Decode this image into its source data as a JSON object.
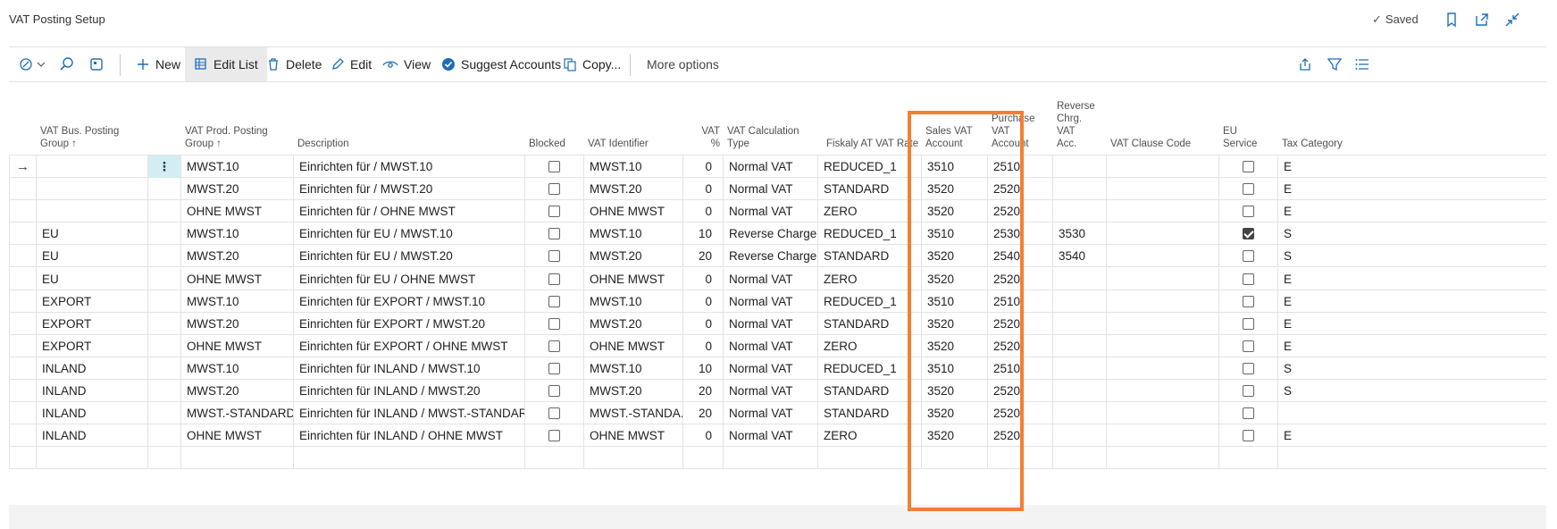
{
  "page": {
    "title": "VAT Posting Setup",
    "saved_label": "Saved"
  },
  "actions": {
    "new": "New",
    "edit_list": "Edit List",
    "delete": "Delete",
    "edit": "Edit",
    "view": "View",
    "suggest_accounts": "Suggest Accounts",
    "copy": "Copy...",
    "more_options": "More options"
  },
  "columns": {
    "bus_group_1": "VAT Bus. Posting",
    "bus_group_2": "Group ↑",
    "prod_group_1": "VAT Prod. Posting",
    "prod_group_2": "Group ↑",
    "description": "Description",
    "blocked": "Blocked",
    "vat_identifier": "VAT Identifier",
    "vat_pct_1": "VAT",
    "vat_pct_2": "%",
    "calc_type_1": "VAT Calculation",
    "calc_type_2": "Type",
    "fiskaly": "Fiskaly AT VAT Rate",
    "sales_acc_1": "Sales VAT",
    "sales_acc_2": "Account",
    "purch_acc_1": "Purchase",
    "purch_acc_2": "VAT",
    "purch_acc_3": "Account",
    "rev_1": "Reverse",
    "rev_2": "Chrg.",
    "rev_3": "VAT",
    "rev_4": "Acc.",
    "clause": "VAT Clause Code",
    "eu_1": "EU",
    "eu_2": "Service",
    "tax_cat": "Tax Category"
  },
  "rows": [
    {
      "bus": "",
      "prod": "MWST.10",
      "desc": "Einrichten für  / MWST.10",
      "blocked": false,
      "ident": "MWST.10",
      "pct": "0",
      "calc": "Normal VAT",
      "fisk": "REDUCED_1",
      "sales": "3510",
      "purch": "2510",
      "rev": "",
      "eu": false,
      "tax": "E"
    },
    {
      "bus": "",
      "prod": "MWST.20",
      "desc": "Einrichten für  / MWST.20",
      "blocked": false,
      "ident": "MWST.20",
      "pct": "0",
      "calc": "Normal VAT",
      "fisk": "STANDARD",
      "sales": "3520",
      "purch": "2520",
      "rev": "",
      "eu": false,
      "tax": "E"
    },
    {
      "bus": "",
      "prod": "OHNE MWST",
      "desc": "Einrichten für  / OHNE MWST",
      "blocked": false,
      "ident": "OHNE MWST",
      "pct": "0",
      "calc": "Normal VAT",
      "fisk": "ZERO",
      "sales": "3520",
      "purch": "2520",
      "rev": "",
      "eu": false,
      "tax": "E"
    },
    {
      "bus": "EU",
      "prod": "MWST.10",
      "desc": "Einrichten für EU / MWST.10",
      "blocked": false,
      "ident": "MWST.10",
      "pct": "10",
      "calc": "Reverse Charge ...",
      "fisk": "REDUCED_1",
      "sales": "3510",
      "purch": "2530",
      "rev": "3530",
      "eu": true,
      "tax": "S"
    },
    {
      "bus": "EU",
      "prod": "MWST.20",
      "desc": "Einrichten für EU / MWST.20",
      "blocked": false,
      "ident": "MWST.20",
      "pct": "20",
      "calc": "Reverse Charge ...",
      "fisk": "STANDARD",
      "sales": "3520",
      "purch": "2540",
      "rev": "3540",
      "eu": false,
      "tax": "S"
    },
    {
      "bus": "EU",
      "prod": "OHNE MWST",
      "desc": "Einrichten für EU / OHNE MWST",
      "blocked": false,
      "ident": "OHNE MWST",
      "pct": "0",
      "calc": "Normal VAT",
      "fisk": "ZERO",
      "sales": "3520",
      "purch": "2520",
      "rev": "",
      "eu": false,
      "tax": "E"
    },
    {
      "bus": "EXPORT",
      "prod": "MWST.10",
      "desc": "Einrichten für EXPORT / MWST.10",
      "blocked": false,
      "ident": "MWST.10",
      "pct": "0",
      "calc": "Normal VAT",
      "fisk": "REDUCED_1",
      "sales": "3510",
      "purch": "2510",
      "rev": "",
      "eu": false,
      "tax": "E"
    },
    {
      "bus": "EXPORT",
      "prod": "MWST.20",
      "desc": "Einrichten für EXPORT / MWST.20",
      "blocked": false,
      "ident": "MWST.20",
      "pct": "0",
      "calc": "Normal VAT",
      "fisk": "STANDARD",
      "sales": "3520",
      "purch": "2520",
      "rev": "",
      "eu": false,
      "tax": "E"
    },
    {
      "bus": "EXPORT",
      "prod": "OHNE MWST",
      "desc": "Einrichten für EXPORT / OHNE MWST",
      "blocked": false,
      "ident": "OHNE MWST",
      "pct": "0",
      "calc": "Normal VAT",
      "fisk": "ZERO",
      "sales": "3520",
      "purch": "2520",
      "rev": "",
      "eu": false,
      "tax": "E"
    },
    {
      "bus": "INLAND",
      "prod": "MWST.10",
      "desc": "Einrichten für INLAND / MWST.10",
      "blocked": false,
      "ident": "MWST.10",
      "pct": "10",
      "calc": "Normal VAT",
      "fisk": "REDUCED_1",
      "sales": "3510",
      "purch": "2510",
      "rev": "",
      "eu": false,
      "tax": "S"
    },
    {
      "bus": "INLAND",
      "prod": "MWST.20",
      "desc": "Einrichten für INLAND / MWST.20",
      "blocked": false,
      "ident": "MWST.20",
      "pct": "20",
      "calc": "Normal VAT",
      "fisk": "STANDARD",
      "sales": "3520",
      "purch": "2520",
      "rev": "",
      "eu": false,
      "tax": "S"
    },
    {
      "bus": "INLAND",
      "prod": "MWST.-STANDARD",
      "desc": "Einrichten für INLAND / MWST.-STANDARD",
      "blocked": false,
      "ident": "MWST.-STANDA...",
      "pct": "20",
      "calc": "Normal VAT",
      "fisk": "STANDARD",
      "sales": "3520",
      "purch": "2520",
      "rev": "",
      "eu": false,
      "tax": ""
    },
    {
      "bus": "INLAND",
      "prod": "OHNE MWST",
      "desc": "Einrichten für INLAND / OHNE MWST",
      "blocked": false,
      "ident": "OHNE MWST",
      "pct": "0",
      "calc": "Normal VAT",
      "fisk": "ZERO",
      "sales": "3520",
      "purch": "2520",
      "rev": "",
      "eu": false,
      "tax": "E"
    }
  ],
  "colors": {
    "accent": "#f28033",
    "selected_cell": "#d3eef3"
  }
}
